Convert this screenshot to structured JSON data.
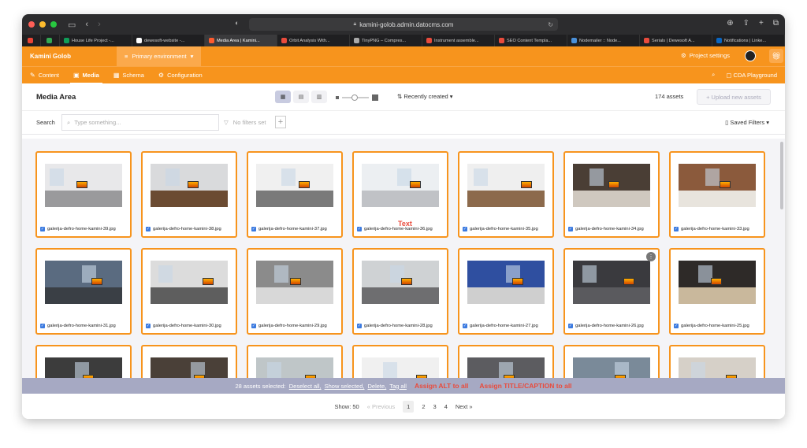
{
  "browser": {
    "url": "kamini-golob.admin.datocms.com",
    "tabs": [
      {
        "label": "",
        "color": "#ea4335",
        "small": true
      },
      {
        "label": "",
        "color": "#34a853",
        "small": true
      },
      {
        "label": "House Life Project -...",
        "color": "#0f9d58"
      },
      {
        "label": "dewesoft-website -...",
        "color": "#ffffff"
      },
      {
        "label": "Media Area | Kamini...",
        "color": "#ff5b2e",
        "active": true
      },
      {
        "label": "Orbit Analysis With...",
        "color": "#e94b3c"
      },
      {
        "label": "TinyPNG – Compres...",
        "color": "#aaaaaa"
      },
      {
        "label": "Instrument assemble...",
        "color": "#e94b3c"
      },
      {
        "label": "SEO Content Templa...",
        "color": "#e94b3c"
      },
      {
        "label": "Nodemailer :: Node...",
        "color": "#4a90d9"
      },
      {
        "label": "Serials | Dewesoft A...",
        "color": "#e94b3c"
      },
      {
        "label": "Notifications | Linke...",
        "color": "#0a66c2"
      }
    ]
  },
  "header": {
    "project": "Kamini Golob",
    "environment": "Primary environment",
    "project_settings": "Project settings",
    "nav": [
      {
        "label": "Content",
        "icon": "edit-icon"
      },
      {
        "label": "Media",
        "icon": "image-icon",
        "active": true
      },
      {
        "label": "Schema",
        "icon": "grid-icon"
      },
      {
        "label": "Configuration",
        "icon": "settings-icon"
      }
    ],
    "cda_playground": "CDA Playground"
  },
  "toolbar": {
    "title": "Media Area",
    "sort": "Recently created",
    "count": "174 assets",
    "upload": "+ Upload new assets"
  },
  "search": {
    "label": "Search",
    "placeholder": "Type something...",
    "filters": "No filters set",
    "saved_filters": "Saved Filters"
  },
  "assets": [
    {
      "name": "galerija-defro-home-kamini-39.jpg",
      "wall": "#e8e8ea",
      "floor": "#9a9a9c"
    },
    {
      "name": "galerija-defro-home-kamini-38.jpg",
      "wall": "#d9dadc",
      "floor": "#6b4b32"
    },
    {
      "name": "galerija-defro-home-kamini-37.jpg",
      "wall": "#f0f0f0",
      "floor": "#7a7a7a"
    },
    {
      "name": "galerija-defro-home-kamini-36.jpg",
      "wall": "#eceff2",
      "floor": "#c0c2c6"
    },
    {
      "name": "galerija-defro-home-kamini-35.jpg",
      "wall": "#efefef",
      "floor": "#8c6a4c"
    },
    {
      "name": "galerija-defro-home-kamini-34.jpg",
      "wall": "#4a3e35",
      "floor": "#cfc8bf"
    },
    {
      "name": "galerija-defro-home-kamini-33.jpg",
      "wall": "#8b5a3c",
      "floor": "#e8e4dd"
    },
    {
      "name": "galerija-defro-home-kamini-31.jpg",
      "wall": "#5a6b80",
      "floor": "#3a3f45"
    },
    {
      "name": "galerija-defro-home-kamini-30.jpg",
      "wall": "#dcdcdc",
      "floor": "#5e5e5e"
    },
    {
      "name": "galerija-defro-home-kamini-29.jpg",
      "wall": "#8b8b8b",
      "floor": "#d8d8d8"
    },
    {
      "name": "galerija-defro-home-kamini-28.jpg",
      "wall": "#cfd2d4",
      "floor": "#6e6e70"
    },
    {
      "name": "galerija-defro-home-kamini-27.jpg",
      "wall": "#2f4fa0",
      "floor": "#cfcfcf"
    },
    {
      "name": "galerija-defro-home-kamini-26.jpg",
      "wall": "#3a3a3e",
      "floor": "#5a5a5e"
    },
    {
      "name": "galerija-defro-home-kamini-25.jpg",
      "wall": "#2e2a28",
      "floor": "#c9b89c"
    },
    {
      "name": "",
      "wall": "#3c3c3c",
      "floor": "#777777"
    },
    {
      "name": "",
      "wall": "#4a4038",
      "floor": "#8d7b6a"
    },
    {
      "name": "",
      "wall": "#bfc6c8",
      "floor": "#555555"
    },
    {
      "name": "",
      "wall": "#f0f0f0",
      "floor": "#888888"
    },
    {
      "name": "",
      "wall": "#5c5c60",
      "floor": "#3f3f42"
    },
    {
      "name": "",
      "wall": "#7a8a99",
      "floor": "#2b2b2b"
    },
    {
      "name": "",
      "wall": "#d6d0c8",
      "floor": "#8c7e6e"
    }
  ],
  "overlay_text": "Text",
  "selection": {
    "text": "28 assets selected:",
    "deselect": "Deselect all,",
    "show_selected": "Show selected,",
    "delete": "Delete,",
    "tag_all": "Tag all",
    "assign_alt": "Assign ALT to all",
    "assign_title": "Assign TITLE/CAPTION to all"
  },
  "pagination": {
    "show": "Show: 50",
    "previous": "« Previous",
    "pages": [
      "1",
      "2",
      "3",
      "4"
    ],
    "next": "Next »"
  }
}
